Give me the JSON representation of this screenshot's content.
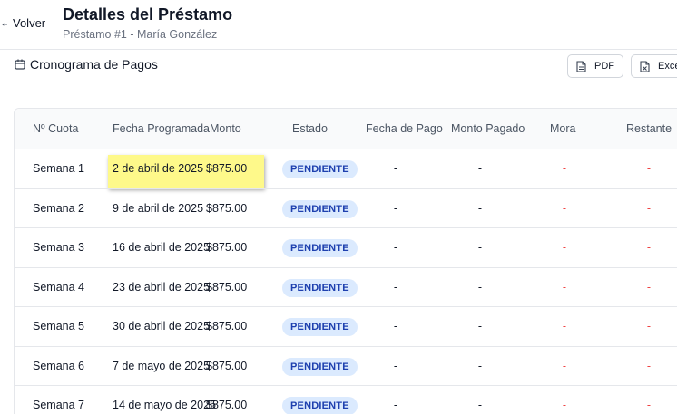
{
  "header": {
    "back_label": "Volver",
    "title": "Detalles del Préstamo",
    "subtitle": "Préstamo #1 - María González"
  },
  "section": {
    "title": "Cronograma de Pagos",
    "icon": "calendar-icon"
  },
  "export": {
    "pdf_label": "PDF",
    "excel_label": "Excel"
  },
  "table": {
    "columns": [
      "Nº Cuota",
      "Fecha Programada",
      "Monto",
      "Estado",
      "Fecha de Pago",
      "Monto Pagado",
      "Mora",
      "Restante"
    ],
    "rows": [
      {
        "cuota": "Semana 1",
        "fecha": "2 de abril de 2025",
        "monto": "$875.00",
        "estado": "PENDIENTE",
        "fecha_pago": "-",
        "monto_pagado": "-",
        "mora": "-",
        "restante": "-"
      },
      {
        "cuota": "Semana 2",
        "fecha": "9 de abril de 2025",
        "monto": "$875.00",
        "estado": "PENDIENTE",
        "fecha_pago": "-",
        "monto_pagado": "-",
        "mora": "-",
        "restante": "-"
      },
      {
        "cuota": "Semana 3",
        "fecha": "16 de abril de 2025",
        "monto": "$875.00",
        "estado": "PENDIENTE",
        "fecha_pago": "-",
        "monto_pagado": "-",
        "mora": "-",
        "restante": "-"
      },
      {
        "cuota": "Semana 4",
        "fecha": "23 de abril de 2025",
        "monto": "$875.00",
        "estado": "PENDIENTE",
        "fecha_pago": "-",
        "monto_pagado": "-",
        "mora": "-",
        "restante": "-"
      },
      {
        "cuota": "Semana 5",
        "fecha": "30 de abril de 2025",
        "monto": "$875.00",
        "estado": "PENDIENTE",
        "fecha_pago": "-",
        "monto_pagado": "-",
        "mora": "-",
        "restante": "-"
      },
      {
        "cuota": "Semana 6",
        "fecha": "7 de mayo de 2025",
        "monto": "$875.00",
        "estado": "PENDIENTE",
        "fecha_pago": "-",
        "monto_pagado": "-",
        "mora": "-",
        "restante": "-"
      },
      {
        "cuota": "Semana 7",
        "fecha": "14 de mayo de 2025",
        "monto": "$875.00",
        "estado": "PENDIENTE",
        "fecha_pago": "-",
        "monto_pagado": "-",
        "mora": "-",
        "restante": "-"
      }
    ]
  },
  "colors": {
    "badge_bg": "#dbeafe",
    "badge_text": "#1e40af",
    "highlight": "#fef98a",
    "mora": "#ef4444"
  }
}
